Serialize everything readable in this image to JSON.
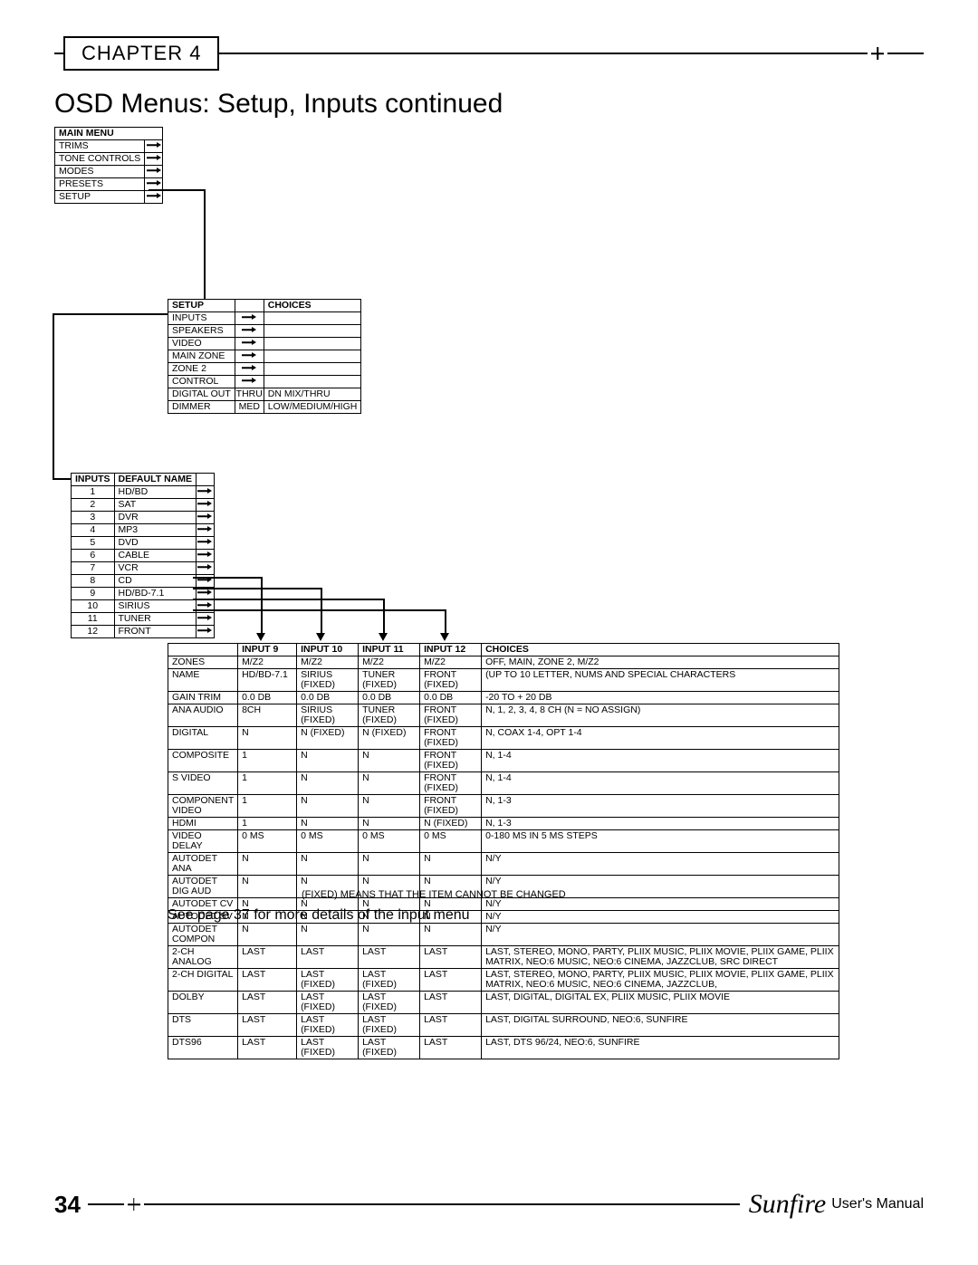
{
  "chapter": "CHAPTER 4",
  "title": "OSD Menus: Setup, Inputs continued",
  "main_menu": {
    "header": "MAIN MENU",
    "items": [
      "TRIMS",
      "TONE CONTROLS",
      "MODES",
      "PRESETS",
      "SETUP"
    ]
  },
  "setup_menu": {
    "headers": [
      "SETUP",
      "",
      "CHOICES"
    ],
    "rows": [
      {
        "label": "INPUTS",
        "arrow": true,
        "choice": ""
      },
      {
        "label": "SPEAKERS",
        "arrow": true,
        "choice": ""
      },
      {
        "label": "VIDEO",
        "arrow": true,
        "choice": ""
      },
      {
        "label": "MAIN ZONE",
        "arrow": true,
        "choice": ""
      },
      {
        "label": "ZONE 2",
        "arrow": true,
        "choice": ""
      },
      {
        "label": "CONTROL",
        "arrow": true,
        "choice": ""
      },
      {
        "label": "DIGITAL OUT",
        "val": "THRU",
        "choice": "DN MIX/THRU"
      },
      {
        "label": "DIMMER",
        "val": "MED",
        "choice": "LOW/MEDIUM/HIGH"
      }
    ]
  },
  "inputs_menu": {
    "headers": [
      "INPUTS",
      "DEFAULT NAME"
    ],
    "rows": [
      {
        "n": "1",
        "name": "HD/BD"
      },
      {
        "n": "2",
        "name": "SAT"
      },
      {
        "n": "3",
        "name": "DVR"
      },
      {
        "n": "4",
        "name": "MP3"
      },
      {
        "n": "5",
        "name": "DVD"
      },
      {
        "n": "6",
        "name": "CABLE"
      },
      {
        "n": "7",
        "name": "VCR"
      },
      {
        "n": "8",
        "name": "CD"
      },
      {
        "n": "9",
        "name": "HD/BD-7.1"
      },
      {
        "n": "10",
        "name": "SIRIUS"
      },
      {
        "n": "11",
        "name": "TUNER"
      },
      {
        "n": "12",
        "name": "FRONT"
      }
    ]
  },
  "detail": {
    "headers": [
      "",
      "INPUT 9",
      "INPUT 10",
      "INPUT 11",
      "INPUT 12",
      "CHOICES"
    ],
    "rows": [
      {
        "r": "ZONES",
        "c": [
          "M/Z2",
          "M/Z2",
          "M/Z2",
          "M/Z2",
          "OFF, MAIN, ZONE 2, M/Z2"
        ]
      },
      {
        "r": "NAME",
        "c": [
          "HD/BD-7.1",
          "SIRIUS (FIXED)",
          "TUNER (FIXED)",
          "FRONT (FIXED)",
          "(UP TO 10 LETTER, NUMS AND SPECIAL CHARACTERS"
        ]
      },
      {
        "r": "GAIN TRIM",
        "c": [
          "0.0 DB",
          "0.0 DB",
          "0.0 DB",
          "0.0 DB",
          "-20 TO + 20 DB"
        ]
      },
      {
        "r": "ANA AUDIO",
        "c": [
          "8CH",
          "SIRIUS (FIXED)",
          "TUNER (FIXED)",
          "FRONT (FIXED)",
          "N, 1, 2, 3, 4, 8 CH (N = NO ASSIGN)"
        ]
      },
      {
        "r": "DIGITAL",
        "c": [
          "N",
          "N (FIXED)",
          "N (FIXED)",
          "FRONT (FIXED)",
          "N, COAX 1-4, OPT 1-4"
        ]
      },
      {
        "r": "COMPOSITE",
        "c": [
          "1",
          "N",
          "N",
          "FRONT (FIXED)",
          "N, 1-4"
        ]
      },
      {
        "r": "S VIDEO",
        "c": [
          "1",
          "N",
          "N",
          "FRONT (FIXED)",
          "N, 1-4"
        ]
      },
      {
        "r": "COMPONENT VIDEO",
        "c": [
          "1",
          "N",
          "N",
          "FRONT (FIXED)",
          "N, 1-3"
        ]
      },
      {
        "r": "HDMI",
        "c": [
          "1",
          "N",
          "N",
          "N (FIXED)",
          "N, 1-3"
        ]
      },
      {
        "r": "VIDEO DELAY",
        "c": [
          "0 MS",
          "0 MS",
          "0 MS",
          "0 MS",
          "0-180 MS IN 5 MS STEPS"
        ]
      },
      {
        "r": "AUTODET ANA",
        "c": [
          "N",
          "N",
          "N",
          "N",
          "N/Y"
        ]
      },
      {
        "r": "AUTODET DIG AUD",
        "c": [
          "N",
          "N",
          "N",
          "N",
          "N/Y"
        ]
      },
      {
        "r": "AUTODET CV",
        "c": [
          "N",
          "N",
          "N",
          "N",
          "N/Y"
        ]
      },
      {
        "r": "AUTODET SV",
        "c": [
          "N",
          "N",
          "N",
          "N",
          "N/Y"
        ]
      },
      {
        "r": "AUTODET COMPON",
        "c": [
          "N",
          "N",
          "N",
          "N",
          "N/Y"
        ]
      },
      {
        "r": "2-CH ANALOG",
        "c": [
          "LAST",
          "LAST",
          "LAST",
          "LAST",
          "LAST, STEREO, MONO, PARTY,  PLIIX MUSIC,  PLIIX MOVIE, PLIIX GAME, PLIIX MATRIX, NEO:6 MUSIC, NEO:6 CINEMA, JAZZCLUB, SRC DIRECT"
        ]
      },
      {
        "r": "2-CH DIGITAL",
        "c": [
          "LAST",
          "LAST (FIXED)",
          "LAST (FIXED)",
          "LAST",
          "LAST, STEREO, MONO, PARTY,  PLIIX MUSIC,  PLIIX MOVIE, PLIIX GAME, PLIIX MATRIX, NEO:6 MUSIC, NEO:6 CINEMA, JAZZCLUB,"
        ]
      },
      {
        "r": "DOLBY",
        "c": [
          "LAST",
          "LAST (FIXED)",
          "LAST (FIXED)",
          "LAST",
          "LAST, DIGITAL, DIGITAL EX, PLIIX MUSIC, PLIIX MOVIE"
        ]
      },
      {
        "r": "DTS",
        "c": [
          "LAST",
          "LAST (FIXED)",
          "LAST (FIXED)",
          "LAST",
          "LAST, DIGITAL SURROUND, NEO:6, SUNFIRE"
        ]
      },
      {
        "r": "DTS96",
        "c": [
          "LAST",
          "LAST (FIXED)",
          "LAST (FIXED)",
          "LAST",
          "LAST, DTS 96/24, NEO:6, SUNFIRE"
        ]
      }
    ]
  },
  "fixed_note": "(FIXED) MEANS THAT THE ITEM CANNOT BE CHANGED",
  "see_page": "See page 37 for more details of the input menu",
  "footer": {
    "page": "34",
    "brand": "Sunfire",
    "manual": "User's Manual"
  }
}
